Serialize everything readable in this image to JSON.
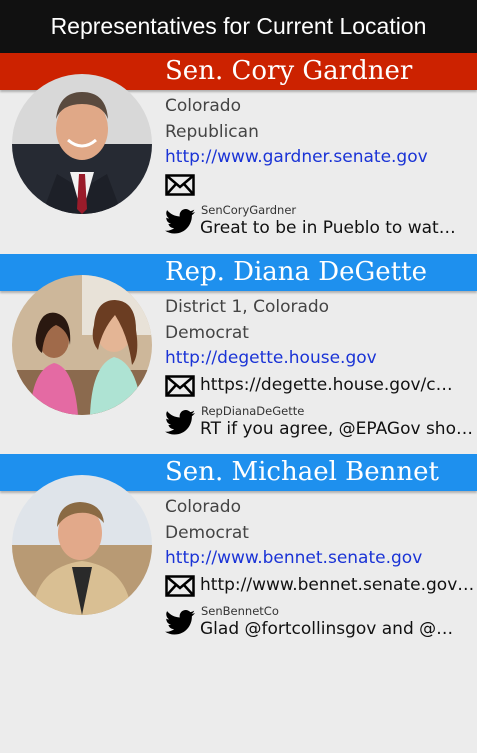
{
  "app": {
    "title": "Representatives for Current Location"
  },
  "representatives": [
    {
      "name": "Sen. Cory Gardner",
      "line1": "Colorado",
      "party": "Republican",
      "website": "http://www.gardner.senate.gov",
      "contact": "",
      "twitter_handle": "SenCoryGardner",
      "tweet": "Great to be in Pueblo to watch the...",
      "bar_color": "#cc2200"
    },
    {
      "name": "Rep. Diana DeGette",
      "line1": "District 1, Colorado",
      "party": "Democrat",
      "website": "http://degette.house.gov",
      "contact": "https://degette.house.gov/contact",
      "twitter_handle": "RepDianaDeGette",
      "tweet": "RT if you agree, @EPAGov should act",
      "bar_color": "#1e90ee"
    },
    {
      "name": "Sen. Michael Bennet",
      "line1": "Colorado",
      "party": "Democrat",
      "website": "http://www.bennet.senate.gov",
      "contact": "http://www.bennet.senate.gov/contact",
      "twitter_handle": "SenBennetCo",
      "tweet": "Glad @fortcollinsgov and @CityofLoveland",
      "bar_color": "#1e90ee"
    }
  ],
  "icons": {
    "mail": "envelope-icon",
    "twitter": "twitter-bird-icon"
  }
}
